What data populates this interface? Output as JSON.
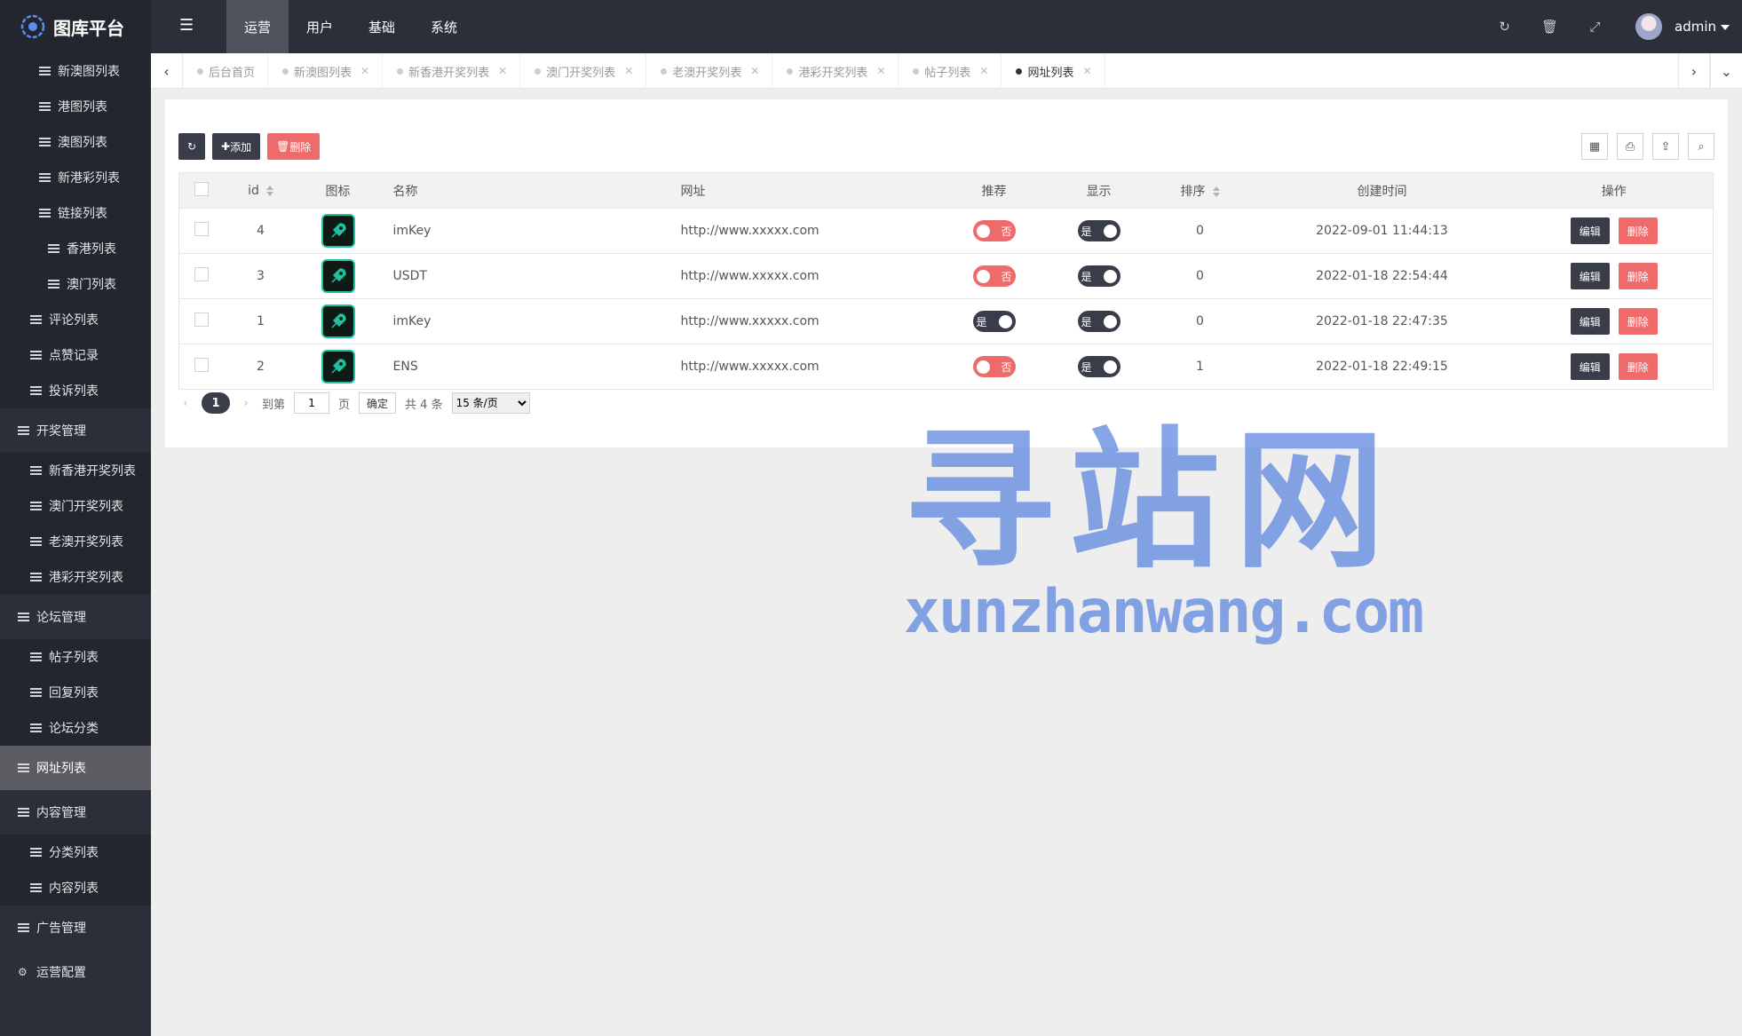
{
  "app": {
    "title": "图库平台"
  },
  "topnav": [
    {
      "label": "运营",
      "active": true
    },
    {
      "label": "用户",
      "active": false
    },
    {
      "label": "基础",
      "active": false
    },
    {
      "label": "系统",
      "active": false
    }
  ],
  "user": {
    "name": "admin"
  },
  "sidebar": [
    {
      "label": "新澳图列表",
      "kind": "sub",
      "indent": 44
    },
    {
      "label": "港图列表",
      "kind": "sub",
      "indent": 44
    },
    {
      "label": "澳图列表",
      "kind": "sub",
      "indent": 44
    },
    {
      "label": "新港彩列表",
      "kind": "sub",
      "indent": 44
    },
    {
      "label": "链接列表",
      "kind": "sub",
      "indent": 44
    },
    {
      "label": "香港列表",
      "kind": "sub2",
      "indent": 54
    },
    {
      "label": "澳门列表",
      "kind": "sub2",
      "indent": 54
    },
    {
      "label": "评论列表",
      "kind": "sub",
      "indent": 34
    },
    {
      "label": "点赞记录",
      "kind": "sub",
      "indent": 34
    },
    {
      "label": "投诉列表",
      "kind": "sub",
      "indent": 34
    },
    {
      "label": "开奖管理",
      "kind": "group",
      "indent": 20
    },
    {
      "label": "新香港开奖列表",
      "kind": "sub",
      "indent": 34
    },
    {
      "label": "澳门开奖列表",
      "kind": "sub",
      "indent": 34
    },
    {
      "label": "老澳开奖列表",
      "kind": "sub",
      "indent": 34
    },
    {
      "label": "港彩开奖列表",
      "kind": "sub",
      "indent": 34
    },
    {
      "label": "论坛管理",
      "kind": "group",
      "indent": 20
    },
    {
      "label": "帖子列表",
      "kind": "sub",
      "indent": 34
    },
    {
      "label": "回复列表",
      "kind": "sub",
      "indent": 34
    },
    {
      "label": "论坛分类",
      "kind": "sub",
      "indent": 34
    },
    {
      "label": "网址列表",
      "kind": "active",
      "indent": 20
    },
    {
      "label": "内容管理",
      "kind": "group",
      "indent": 20
    },
    {
      "label": "分类列表",
      "kind": "sub",
      "indent": 34
    },
    {
      "label": "内容列表",
      "kind": "sub",
      "indent": 34
    },
    {
      "label": "广告管理",
      "kind": "group",
      "indent": 20
    },
    {
      "label": "运营配置",
      "kind": "group-gear",
      "indent": 20
    }
  ],
  "tabs": [
    {
      "label": "后台首页",
      "closable": false,
      "active": false
    },
    {
      "label": "新澳图列表",
      "closable": true,
      "active": false
    },
    {
      "label": "新香港开奖列表",
      "closable": true,
      "active": false
    },
    {
      "label": "澳门开奖列表",
      "closable": true,
      "active": false
    },
    {
      "label": "老澳开奖列表",
      "closable": true,
      "active": false
    },
    {
      "label": "港彩开奖列表",
      "closable": true,
      "active": false
    },
    {
      "label": "帖子列表",
      "closable": true,
      "active": false
    },
    {
      "label": "网址列表",
      "closable": true,
      "active": true
    }
  ],
  "toolbar": {
    "add_label": "添加",
    "delete_label": "删除"
  },
  "table": {
    "columns": {
      "id": "id",
      "icon": "图标",
      "name": "名称",
      "url": "网址",
      "recommend": "推荐",
      "show": "显示",
      "sort": "排序",
      "created": "创建时间",
      "ops": "操作"
    },
    "rows": [
      {
        "id": "4",
        "name": "imKey",
        "url": "http://www.xxxxx.com",
        "recommend": "否",
        "recommend_on": false,
        "show": "是",
        "show_on": true,
        "sort": "0",
        "created": "2022-09-01 11:44:13"
      },
      {
        "id": "3",
        "name": "USDT",
        "url": "http://www.xxxxx.com",
        "recommend": "否",
        "recommend_on": false,
        "show": "是",
        "show_on": true,
        "sort": "0",
        "created": "2022-01-18 22:54:44"
      },
      {
        "id": "1",
        "name": "imKey",
        "url": "http://www.xxxxx.com",
        "recommend": "是",
        "recommend_on": true,
        "show": "是",
        "show_on": true,
        "sort": "0",
        "created": "2022-01-18 22:47:35"
      },
      {
        "id": "2",
        "name": "ENS",
        "url": "http://www.xxxxx.com",
        "recommend": "否",
        "recommend_on": false,
        "show": "是",
        "show_on": true,
        "sort": "1",
        "created": "2022-01-18 22:49:15"
      }
    ],
    "edit_label": "编辑",
    "delete_label": "删除"
  },
  "pager": {
    "current": "1",
    "goto_label": "到第",
    "goto_value": "1",
    "page_label": "页",
    "confirm_label": "确定",
    "total_label": "共 4 条",
    "per_page": "15 条/页"
  },
  "watermark": {
    "cn": "寻站网",
    "en": "xunzhanwang.com"
  },
  "colors": {
    "dark": "#393d49",
    "danger": "#ef6b6b",
    "sidebar": "#2b2f3a",
    "accent_icon": "#1ec1a0"
  }
}
